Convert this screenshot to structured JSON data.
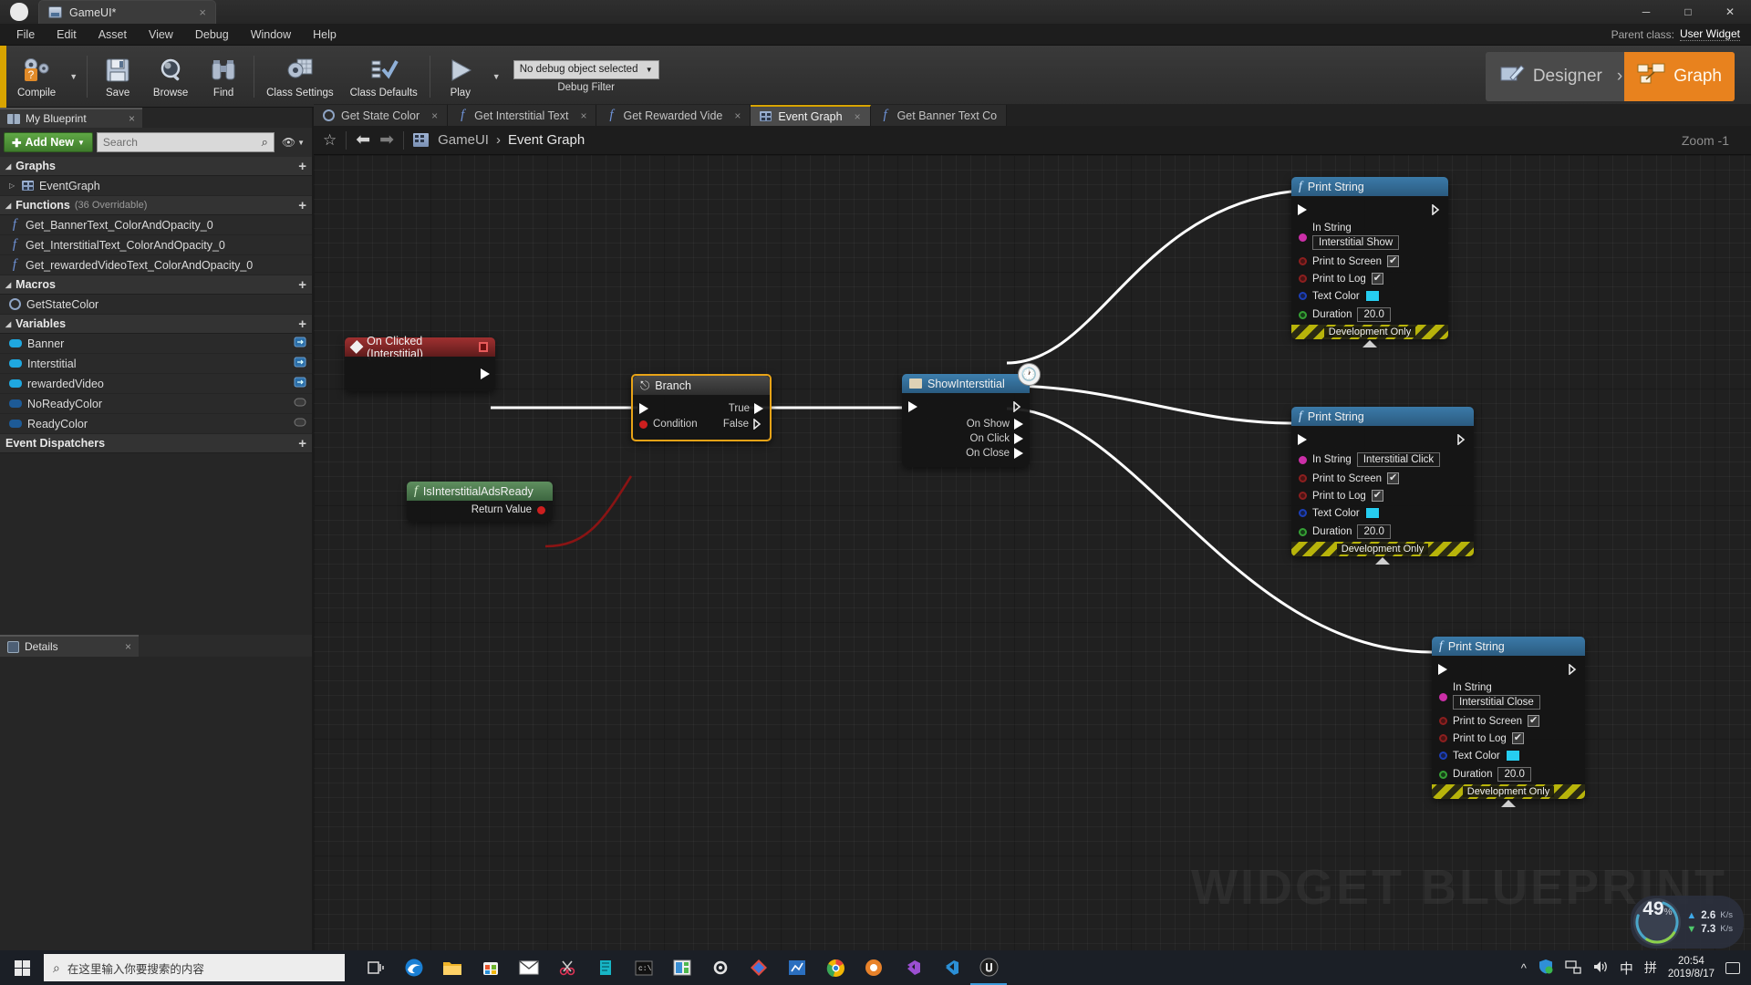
{
  "titlebar": {
    "app_icon": "unreal-logo",
    "tab_label": "GameUI*",
    "tab_close": "×",
    "minimize": "─",
    "maximize": "□",
    "close": "✕"
  },
  "menubar": {
    "items": [
      "File",
      "Edit",
      "Asset",
      "View",
      "Debug",
      "Window",
      "Help"
    ],
    "parent_class_label": "Parent class:",
    "parent_class_value": "User Widget"
  },
  "toolbar": {
    "items": [
      {
        "label": "Compile",
        "icon": "compile-question-gear-icon"
      },
      {
        "label": "Save",
        "icon": "save-floppy-icon"
      },
      {
        "label": "Browse",
        "icon": "browse-magnifier-icon"
      },
      {
        "label": "Find",
        "icon": "find-binoculars-icon"
      },
      {
        "label": "Class Settings",
        "icon": "class-settings-gear-icon"
      },
      {
        "label": "Class Defaults",
        "icon": "class-defaults-checklist-icon"
      },
      {
        "label": "Play",
        "icon": "play-triangle-icon"
      }
    ],
    "debug_value": "No debug object selected",
    "debug_caption": "Debug Filter",
    "mode_designer": "Designer",
    "mode_graph": "Graph",
    "mode_separator": "›"
  },
  "my_blueprint": {
    "tab_title": "My Blueprint",
    "tab_close": "×",
    "add_new": "Add New",
    "search_placeholder": "Search",
    "sections": [
      {
        "name": "Graphs",
        "count": "",
        "items": [
          {
            "label": "EventGraph",
            "icon": "graph-grid-icon",
            "expandable": true
          }
        ]
      },
      {
        "name": "Functions",
        "count": "(36 Overridable)",
        "items": [
          {
            "label": "Get_BannerText_ColorAndOpacity_0",
            "icon": "function-icon"
          },
          {
            "label": "Get_InterstitialText_ColorAndOpacity_0",
            "icon": "function-icon"
          },
          {
            "label": "Get_rewardedVideoText_ColorAndOpacity_0",
            "icon": "function-icon"
          }
        ]
      },
      {
        "name": "Macros",
        "count": "",
        "items": [
          {
            "label": "GetStateColor",
            "icon": "macro-gear-icon"
          }
        ]
      },
      {
        "name": "Variables",
        "count": "",
        "items": [
          {
            "label": "Banner",
            "icon": "variable-object-icon",
            "swatch": "#1fa8e0"
          },
          {
            "label": "Interstitial",
            "icon": "variable-object-icon",
            "swatch": "#1fa8e0"
          },
          {
            "label": "rewardedVideo",
            "icon": "variable-object-icon",
            "swatch": "#1fa8e0"
          },
          {
            "label": "NoReadyColor",
            "icon": "variable-struct-icon",
            "swatch": "#1d5a96"
          },
          {
            "label": "ReadyColor",
            "icon": "variable-struct-icon",
            "swatch": "#1d5a96"
          }
        ]
      },
      {
        "name": "Event Dispatchers",
        "count": "",
        "items": []
      }
    ],
    "details_tab": "Details",
    "details_close": "×"
  },
  "graph_tabs": [
    {
      "label": "Get State Color",
      "icon": "macro-gear-icon",
      "active": false
    },
    {
      "label": "Get Interstitial Text",
      "icon": "function-icon",
      "active": false
    },
    {
      "label": "Get Rewarded Vide",
      "icon": "function-icon",
      "active": false
    },
    {
      "label": "Event Graph",
      "icon": "graph-grid-icon",
      "active": true
    },
    {
      "label": "Get Banner Text Co",
      "icon": "function-icon",
      "active": false
    }
  ],
  "navbar": {
    "breadcrumb_root": "GameUI",
    "breadcrumb_sep": "›",
    "breadcrumb_current": "Event Graph",
    "zoom_label": "Zoom -1"
  },
  "graph": {
    "watermark": "WIDGET BLUEPRINT",
    "nodes": [
      {
        "id": "on-clicked-interstitial",
        "type": "event",
        "title": "On Clicked (Interstitial)"
      },
      {
        "id": "is-interstitial-ads-ready",
        "type": "pure-function",
        "title": "IsInterstitialAdsReady",
        "output_label": "Return Value"
      },
      {
        "id": "branch",
        "type": "flow",
        "title": "Branch",
        "condition_label": "Condition",
        "true_label": "True",
        "false_label": "False"
      },
      {
        "id": "show-interstitial",
        "type": "latent-function",
        "title": "ShowInterstitial",
        "on_show": "On Show",
        "on_click": "On Click",
        "on_close": "On Close",
        "badge": "clock-icon"
      },
      {
        "id": "print-string-show",
        "type": "function",
        "title": "Print String",
        "in_string_label": "In String",
        "in_string_value": "Interstitial Show",
        "print_to_screen_label": "Print to Screen",
        "print_to_screen_checked": true,
        "print_to_log_label": "Print to Log",
        "print_to_log_checked": true,
        "text_color_label": "Text Color",
        "text_color_value": "#26cdf0",
        "duration_label": "Duration",
        "duration_value": "20.0",
        "footer": "Development Only"
      },
      {
        "id": "print-string-click",
        "type": "function",
        "title": "Print String",
        "in_string_label": "In String",
        "in_string_value": "Interstitial Click",
        "print_to_screen_label": "Print to Screen",
        "print_to_screen_checked": true,
        "print_to_log_label": "Print to Log",
        "print_to_log_checked": true,
        "text_color_label": "Text Color",
        "text_color_value": "#26cdf0",
        "duration_label": "Duration",
        "duration_value": "20.0",
        "footer": "Development Only"
      },
      {
        "id": "print-string-close",
        "type": "function",
        "title": "Print String",
        "in_string_label": "In String",
        "in_string_value": "Interstitial Close",
        "print_to_screen_label": "Print to Screen",
        "print_to_screen_checked": true,
        "print_to_log_label": "Print to Log",
        "print_to_log_checked": true,
        "text_color_label": "Text Color",
        "text_color_value": "#26cdf0",
        "duration_label": "Duration",
        "duration_value": "20.0",
        "footer": "Development Only"
      }
    ]
  },
  "net_widget": {
    "percent": "49",
    "percent_unit": "%",
    "upload": "2.6",
    "upload_unit": "K/s",
    "download": "7.3",
    "download_unit": "K/s"
  },
  "taskbar": {
    "search_placeholder": "在这里输入你要搜索的内容",
    "icons": [
      "task-view-icon",
      "edge-icon",
      "file-explorer-icon",
      "store-icon",
      "mail-icon",
      "snip-icon",
      "app-teal-icon",
      "console-icon",
      "app-green-icon",
      "settings-gear-icon",
      "app-diamond-icon",
      "app-blue-icon",
      "chrome-icon",
      "app-orange-icon",
      "vs-icon",
      "vscode-icon",
      "unreal-icon"
    ],
    "tray": {
      "chevron": "^",
      "shield": "security-icon",
      "network": "network-icon",
      "volume": "volume-icon",
      "ime_lang": "中",
      "ime_mode": "拼",
      "time": "20:54",
      "date": "2019/8/17",
      "notifications": "notification-icon"
    }
  }
}
